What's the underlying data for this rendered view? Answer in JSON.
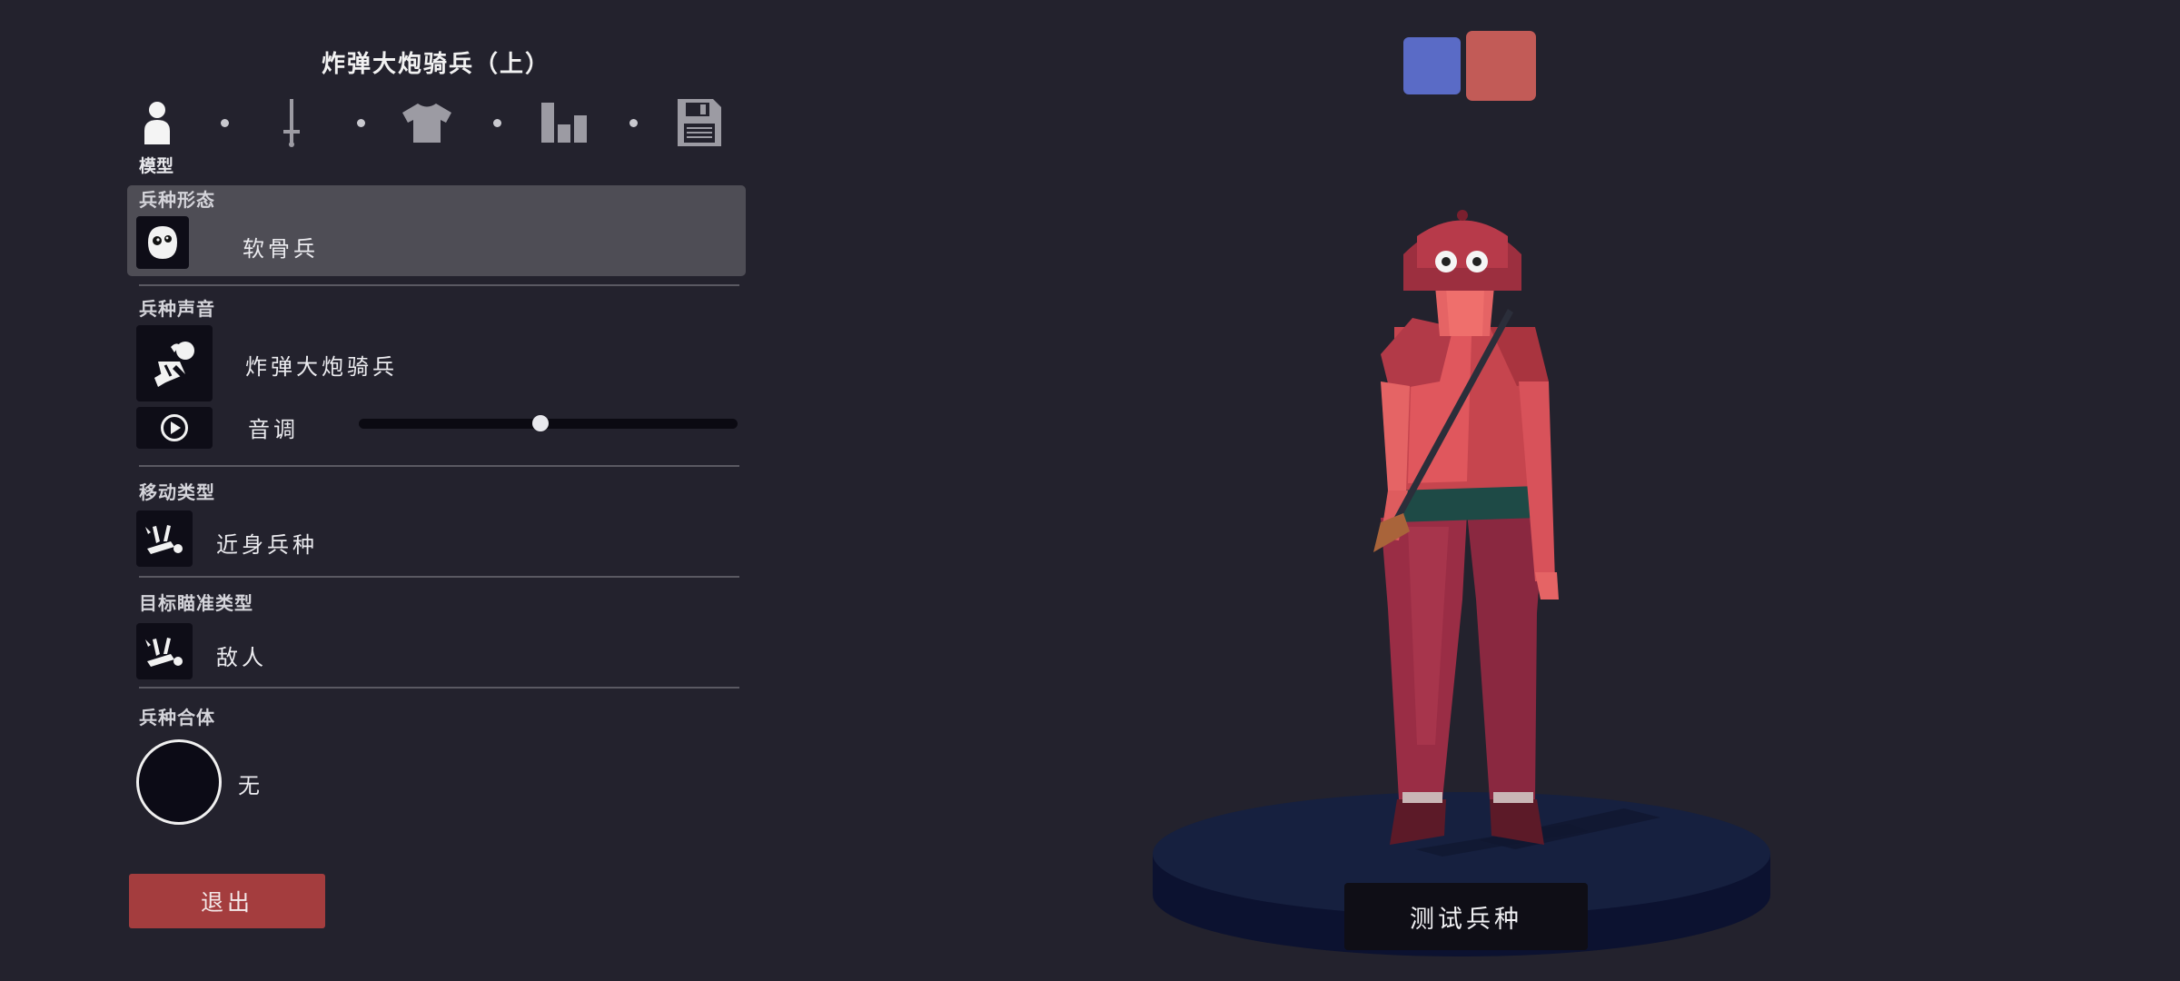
{
  "header": {
    "title": "炸弹大炮骑兵（上）"
  },
  "tabs": {
    "items": [
      {
        "icon": "person-icon",
        "label": "模型",
        "active": true
      },
      {
        "icon": "sword-icon",
        "label": "",
        "active": false
      },
      {
        "icon": "shirt-icon",
        "label": "",
        "active": false
      },
      {
        "icon": "bar-chart-icon",
        "label": "",
        "active": false
      },
      {
        "icon": "save-icon",
        "label": "",
        "active": false
      }
    ]
  },
  "unit_form": {
    "label": "兵种形态",
    "icon": "ghost-face-icon",
    "value": "软骨兵"
  },
  "unit_voice": {
    "label": "兵种声音",
    "icon": "voice-character-icon",
    "value": "炸弹大炮骑兵",
    "pitch_label": "音调",
    "pitch_level": 0.48,
    "play_icon": "play-icon"
  },
  "movement": {
    "label": "移动类型",
    "icon": "melee-fallen-unit-icon",
    "value": "近身兵种"
  },
  "targeting": {
    "label": "目标瞄准类型",
    "icon": "enemy-fallen-unit-icon",
    "value": "敌人"
  },
  "combine": {
    "label": "兵种合体",
    "value": "无"
  },
  "buttons": {
    "exit_label": "退出",
    "test_label": "测试兵种"
  },
  "team_colors": {
    "blue": "#5a6bc6",
    "red": "#c25b57",
    "selected": "red"
  },
  "colors": {
    "background": "#23222d",
    "exit": "#a43d3e",
    "stage": "#141b36"
  }
}
